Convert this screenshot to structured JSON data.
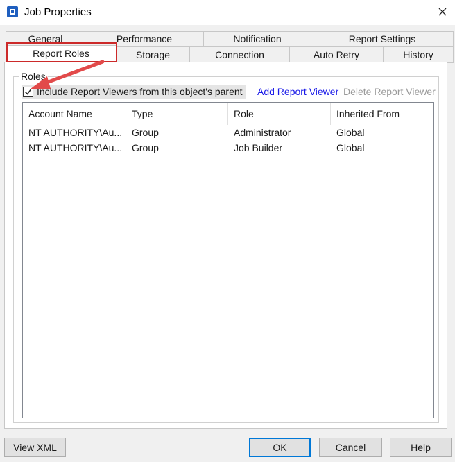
{
  "window": {
    "title": "Job Properties"
  },
  "tabs_row1": [
    {
      "label": "General"
    },
    {
      "label": "Performance"
    },
    {
      "label": "Notification"
    },
    {
      "label": "Report Settings"
    }
  ],
  "tabs_row2": [
    {
      "label": "Report Roles",
      "active": true
    },
    {
      "label": "Storage"
    },
    {
      "label": "Connection"
    },
    {
      "label": "Auto Retry"
    },
    {
      "label": "History"
    }
  ],
  "roles": {
    "group_label": "Roles",
    "include_checkbox": {
      "label": "Include Report Viewers from this object's parent",
      "checked": true
    },
    "add_link": "Add Report Viewer",
    "delete_link": "Delete Report Viewer",
    "columns": [
      "Account Name",
      "Type",
      "Role",
      "Inherited From"
    ],
    "rows": [
      [
        "NT AUTHORITY\\Au...",
        "Group",
        "Administrator",
        "Global"
      ],
      [
        "NT AUTHORITY\\Au...",
        "Group",
        "Job Builder",
        "Global"
      ]
    ]
  },
  "buttons": {
    "view_xml": "View XML",
    "ok": "OK",
    "cancel": "Cancel",
    "help": "Help"
  },
  "colors": {
    "highlight": "#cc2a2a",
    "arrow": "#e24a4a",
    "link": "#1a1ae8",
    "default_button_border": "#0078d7"
  }
}
